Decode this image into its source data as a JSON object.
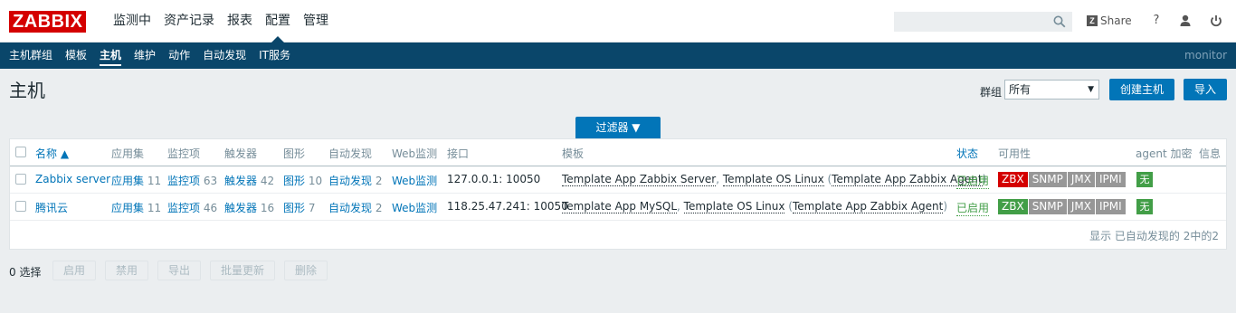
{
  "header": {
    "logo": "ZABBIX",
    "menu": [
      "监测中",
      "资产记录",
      "报表",
      "配置",
      "管理"
    ],
    "search_placeholder": "",
    "share_label": "Share",
    "help_glyph": "?",
    "icons": [
      "search-icon",
      "share-icon",
      "help-icon",
      "user-icon",
      "power-icon"
    ]
  },
  "subnav": {
    "items": [
      "主机群组",
      "模板",
      "主机",
      "维护",
      "动作",
      "自动发现",
      "IT服务"
    ],
    "user": "monitor"
  },
  "page": {
    "title": "主机",
    "group_label": "群组",
    "group_value": "所有",
    "create_button": "创建主机",
    "import_button": "导入",
    "filter_tab": "过滤器 ▼"
  },
  "table": {
    "headers": {
      "name": "名称 ▲",
      "apps": "应用集",
      "items": "监控项",
      "triggers": "触发器",
      "graphs": "图形",
      "discovery": "自动发现",
      "web": "Web监测",
      "iface": "接口",
      "templates": "模板",
      "status": "状态",
      "availability": "可用性",
      "agent_enc": "agent 加密",
      "info": "信息"
    },
    "rows": [
      {
        "name": "Zabbix server",
        "apps_label": "应用集",
        "apps_count": "11",
        "items_label": "监控项",
        "items_count": "63",
        "triggers_label": "触发器",
        "triggers_count": "42",
        "graphs_label": "图形",
        "graphs_count": "10",
        "disc_label": "自动发现",
        "disc_count": "2",
        "web": "Web监测",
        "iface": "127.0.0.1: 10050",
        "tpl1": "Template App Zabbix Server",
        "tpl_sep": ", ",
        "tpl2": "Template OS Linux",
        "tpl_open": " (",
        "tpl3": "Template App Zabbix Agent",
        "tpl_close": ")",
        "status": "已启用",
        "avail": [
          "ZBX",
          "SNMP",
          "JMX",
          "IPMI"
        ],
        "agent_enc": "无"
      },
      {
        "name": "腾讯云",
        "apps_label": "应用集",
        "apps_count": "11",
        "items_label": "监控项",
        "items_count": "46",
        "triggers_label": "触发器",
        "triggers_count": "16",
        "graphs_label": "图形",
        "graphs_count": "7",
        "disc_label": "自动发现",
        "disc_count": "2",
        "web": "Web监测",
        "iface": "118.25.47.241: 10050",
        "tpl1": "Template App MySQL",
        "tpl_sep": ", ",
        "tpl2": "Template OS Linux",
        "tpl_open": " (",
        "tpl3": "Template App Zabbix Agent",
        "tpl_close": ")",
        "status": "已启用",
        "avail": [
          "ZBX",
          "SNMP",
          "JMX",
          "IPMI"
        ],
        "agent_enc": "无"
      }
    ],
    "footer": "显示 已自动发现的 2中的2"
  },
  "actions": {
    "selected": "0 选择",
    "buttons": [
      "启用",
      "禁用",
      "导出",
      "批量更新",
      "删除"
    ]
  },
  "colors": {
    "zbx_red": "#d40000",
    "zbx_green": "#429e47",
    "avail_gray": "#979797",
    "primary_blue": "#0275b8",
    "nav_dark": "#0a466a"
  }
}
